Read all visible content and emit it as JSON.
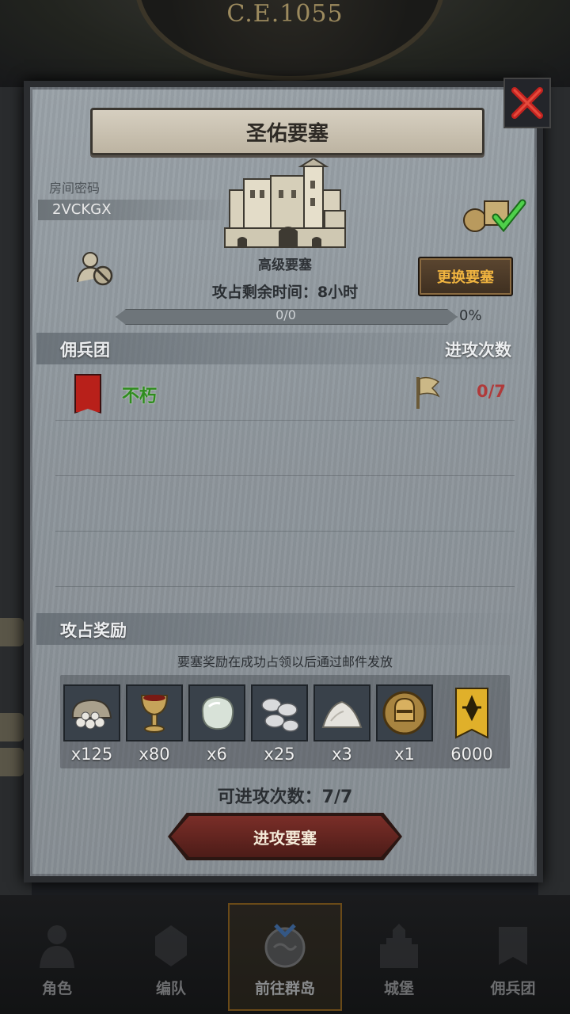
{
  "background": {
    "year_label": "C.E.1055"
  },
  "dialog": {
    "title": "圣佑要塞",
    "room_password_label": "房间密码",
    "room_password": "2VCKGX",
    "fortress_grade": "高级要塞",
    "change_button": "更换要塞",
    "time_remaining": "攻占剩余时间：8小时",
    "progress_text": "0/0",
    "progress_percent": "0%",
    "progress_fraction": 0,
    "mercenary_section": {
      "title": "佣兵团",
      "attack_count_header": "进攻次数",
      "rows": [
        {
          "name": "不朽",
          "attacks": "0/7"
        }
      ]
    },
    "reward_section": {
      "title": "攻占奖励",
      "note": "要塞奖励在成功占领以后通过邮件发放",
      "items": [
        {
          "icon": "coin-sack-icon",
          "qty": "x125"
        },
        {
          "icon": "goblet-icon",
          "qty": "x80"
        },
        {
          "icon": "gem-stone-icon",
          "qty": "x6"
        },
        {
          "icon": "silver-coins-icon",
          "qty": "x25"
        },
        {
          "icon": "salt-pile-icon",
          "qty": "x3"
        },
        {
          "icon": "knight-helmet-medal-icon",
          "qty": "x1"
        },
        {
          "icon": "guild-banner-icon",
          "qty": "6000"
        }
      ]
    },
    "remaining_attacks": "可进攻次数：7/7",
    "attack_button": "进攻要塞"
  },
  "bottom_nav": {
    "items": [
      {
        "label": "角色",
        "icon": "character-icon"
      },
      {
        "label": "编队",
        "icon": "formation-icon"
      },
      {
        "label": "前往群岛",
        "icon": "islands-icon",
        "active": true
      },
      {
        "label": "城堡",
        "icon": "castle-icon"
      },
      {
        "label": "佣兵团",
        "icon": "mercenary-icon"
      }
    ]
  },
  "colors": {
    "accent_gold": "#f0b440",
    "ally_green": "#2f8c1e",
    "attack_red": "#b03a3a"
  }
}
